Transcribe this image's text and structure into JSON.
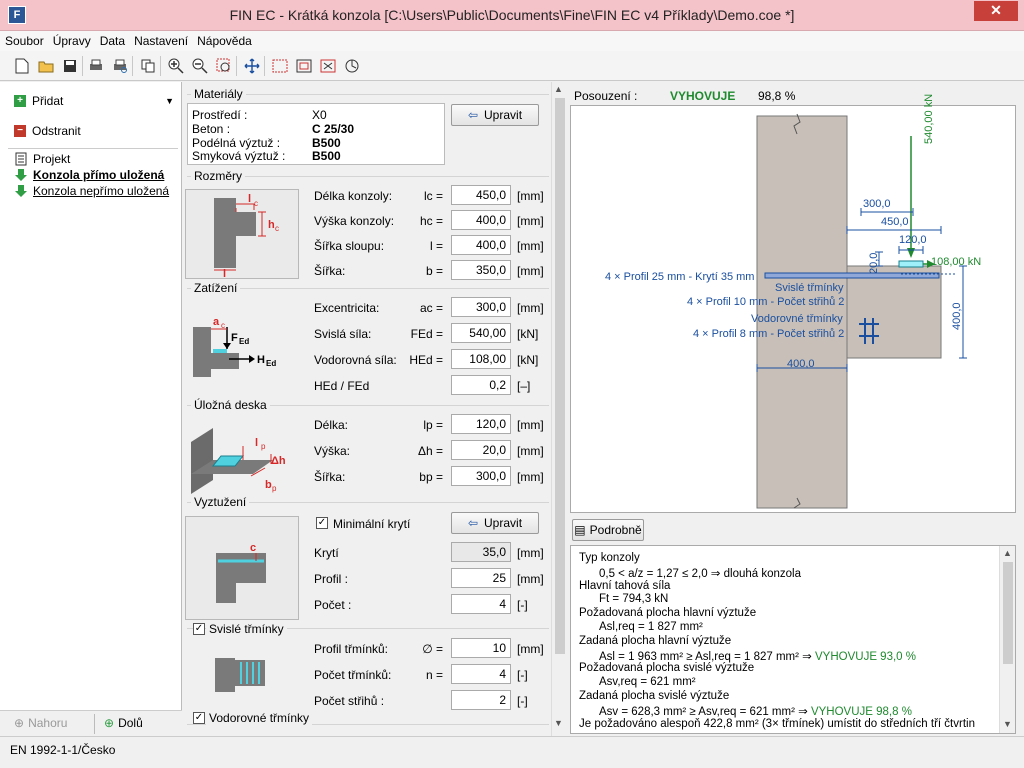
{
  "window": {
    "title": "FIN EC - Krátká konzola [C:\\Users\\Public\\Documents\\Fine\\FIN EC v4 Příklady\\Demo.coe *]",
    "close": "✕"
  },
  "menu": [
    "Soubor",
    "Úpravy",
    "Data",
    "Nastavení",
    "Nápověda"
  ],
  "toolbar_icons": [
    "new-icon",
    "open-icon",
    "save-icon",
    "print-icon",
    "print-preview-icon",
    "copy-icon",
    "zoom-in-icon",
    "zoom-out-icon",
    "zoom-window-icon",
    "pan-icon",
    "fit-icon",
    "frame-icon",
    "fullscreen-icon",
    "redraw-icon"
  ],
  "left": {
    "add": "Přidat",
    "remove": "Odstranit",
    "tree": [
      {
        "label": "Projekt",
        "icon": "document-icon"
      },
      {
        "label": "Konzola přímo uložená",
        "icon": "arrow-down-green-icon"
      },
      {
        "label": "Konzola nepřímo uložená",
        "icon": "arrow-down-green-icon"
      }
    ],
    "up": "Nahoru",
    "down": "Dolů"
  },
  "materials": {
    "title": "Materiály",
    "rows": [
      {
        "k": "Prostředí :",
        "v": "X0"
      },
      {
        "k": "Beton :",
        "v": "C 25/30"
      },
      {
        "k": "Podélná výztuž :",
        "v": "B500"
      },
      {
        "k": "Smyková výztuž :",
        "v": "B500"
      }
    ],
    "edit": "Upravit"
  },
  "dims": {
    "title": "Rozměry",
    "rows": [
      {
        "label": "Délka konzoly:",
        "sym": "lc =",
        "value": "450,0",
        "unit": "[mm]"
      },
      {
        "label": "Výška konzoly:",
        "sym": "hc =",
        "value": "400,0",
        "unit": "[mm]"
      },
      {
        "label": "Šířka sloupu:",
        "sym": "l =",
        "value": "400,0",
        "unit": "[mm]"
      },
      {
        "label": "Šířka:",
        "sym": "b =",
        "value": "350,0",
        "unit": "[mm]"
      }
    ]
  },
  "load": {
    "title": "Zatížení",
    "rows": [
      {
        "label": "Excentricita:",
        "sym": "ac =",
        "value": "300,0",
        "unit": "[mm]"
      },
      {
        "label": "Svislá síla:",
        "sym": "FEd =",
        "value": "540,00",
        "unit": "[kN]"
      },
      {
        "label": "Vodorovná síla:",
        "sym": "HEd =",
        "value": "108,00",
        "unit": "[kN]"
      },
      {
        "label": "HEd / FEd",
        "sym": "",
        "value": "0,2",
        "unit": "[–]"
      }
    ]
  },
  "plate": {
    "title": "Úložná deska",
    "rows": [
      {
        "label": "Délka:",
        "sym": "lp =",
        "value": "120,0",
        "unit": "[mm]"
      },
      {
        "label": "Výška:",
        "sym": "Δh =",
        "value": "20,0",
        "unit": "[mm]"
      },
      {
        "label": "Šířka:",
        "sym": "bp =",
        "value": "300,0",
        "unit": "[mm]"
      }
    ]
  },
  "reinf": {
    "title": "Vyztužení",
    "min_cover": "Minimální krytí",
    "edit": "Upravit",
    "rows": [
      {
        "label": "Krytí",
        "value": "35,0",
        "unit": "[mm]"
      },
      {
        "label": "Profil :",
        "value": "25",
        "unit": "[mm]"
      },
      {
        "label": "Počet :",
        "value": "4",
        "unit": "[-]"
      }
    ]
  },
  "stirrups": {
    "vertical": "Svislé třmínky",
    "horizontal": "Vodorovné třmínky",
    "rows": [
      {
        "label": "Profil třmínků:",
        "sym": "∅ =",
        "value": "10",
        "unit": "[mm]"
      },
      {
        "label": "Počet třmínků:",
        "sym": "n =",
        "value": "4",
        "unit": "[-]"
      },
      {
        "label": "Počet střihů :",
        "sym": "",
        "value": "2",
        "unit": "[-]"
      }
    ]
  },
  "assessment": {
    "label": "Posouzení :",
    "status": "VYHOVUJE",
    "percent": "98,8 %"
  },
  "drawing": {
    "dims": {
      "d300": "300,0",
      "d450": "450,0",
      "d120": "120,0",
      "d20": "20,0",
      "d400v": "400,0",
      "d400h": "400,0"
    },
    "forces": {
      "F": "540,00 kN",
      "H": "108,00 kN"
    },
    "labels": [
      "4 × Profil 25 mm - Krytí 35 mm",
      "Svislé třmínky",
      "4 × Profil 10 mm - Počet střihů 2",
      "Vodorovné třmínky",
      "4 × Profil 8 mm - Počet střihů 2"
    ]
  },
  "detail_btn": "Podrobně",
  "details": [
    {
      "t": "Typ konzoly",
      "i": 0
    },
    {
      "t": "0,5 < a/z = 1,27 ≤ 2,0 ⇒ dlouhá konzola",
      "i": 1
    },
    {
      "t": "Hlavní tahová síla",
      "i": 0
    },
    {
      "t": "Ft = 794,3 kN",
      "i": 1
    },
    {
      "t": "Požadovaná plocha hlavní výztuže",
      "i": 0
    },
    {
      "t": "Asl,req = 1 827 mm²",
      "i": 1
    },
    {
      "t": "Zadaná plocha hlavní výztuže",
      "i": 0
    },
    {
      "t": "Asl = 1 963 mm² ≥ Asl,req = 1 827 mm² ⇒ ",
      "ok": "VYHOVUJE 93,0 %",
      "i": 1
    },
    {
      "t": "Požadovaná plocha svislé výztuže",
      "i": 0
    },
    {
      "t": "Asv,req = 621 mm²",
      "i": 1
    },
    {
      "t": "Zadaná plocha svislé výztuže",
      "i": 0
    },
    {
      "t": "Asv = 628,3 mm² ≥ Asv,req = 621 mm² ⇒ ",
      "ok": "VYHOVUJE 98,8 %",
      "i": 1
    },
    {
      "t": "Je požadováno alespoň 422,8 mm² (3× třmínek) umístit do středních tří čtvrtin",
      "i": 0
    }
  ],
  "status": "EN 1992-1-1/Česko"
}
